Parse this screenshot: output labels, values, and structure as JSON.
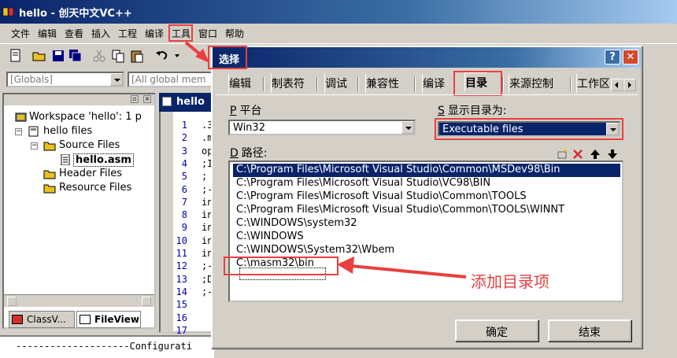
{
  "window": {
    "title": "hello - 创天中文VC++"
  },
  "menu": [
    "文件",
    "编辑",
    "查看",
    "插入",
    "工程",
    "编译",
    "工具",
    "窗口",
    "帮助"
  ],
  "toolbar": {
    "globals_combo": "[Globals]",
    "members_combo": "[All global mem"
  },
  "workspace": {
    "root": "Workspace 'hello': 1 p",
    "project": "hello files",
    "source_folder": "Source Files",
    "source_file": "hello.asm",
    "header_folder": "Header Files",
    "resource_folder": "Resource Files",
    "tabs": [
      "ClassV...",
      "FileView"
    ]
  },
  "editor": {
    "tab": "hello",
    "line_numbers": [
      "1",
      "2",
      "3",
      "4",
      "5",
      "6",
      "7",
      "8",
      "9",
      "10",
      "11",
      "12",
      "13",
      "14",
      "15",
      "16",
      "17"
    ],
    "lines": [
      ".3",
      ".m",
      "op",
      ";I",
      ";",
      ";-",
      "in",
      "in",
      "in",
      "in",
      "in",
      ";-",
      ";D",
      ";-",
      "",
      "",
      ""
    ]
  },
  "output": {
    "text": "--------------------Configurati"
  },
  "dialog": {
    "title": "选择",
    "help_label": "?",
    "close_label": "✕",
    "tabs": [
      "编辑",
      "制表符",
      "调试",
      "兼容性",
      "编译",
      "目录",
      "来源控制",
      "工作区"
    ],
    "active_tab": "目录",
    "platform_label_key": "P",
    "platform_label": "平台",
    "platform_value": "Win32",
    "show_dirs_key": "S",
    "show_dirs_label": "显示目录为:",
    "show_dirs_value": "Executable files",
    "dirs_key": "D",
    "dirs_label": "路径:",
    "directories": [
      "C:\\Program Files\\Microsoft Visual Studio\\Common\\MSDev98\\Bin",
      "C:\\Program Files\\Microsoft Visual Studio\\VC98\\BIN",
      "C:\\Program Files\\Microsoft Visual Studio\\Common\\TOOLS",
      "C:\\Program Files\\Microsoft Visual Studio\\Common\\TOOLS\\WINNT",
      "C:\\WINDOWS\\system32",
      "C:\\WINDOWS",
      "C:\\WINDOWS\\System32\\Wbem",
      "C:\\masm32\\bin"
    ],
    "ok_button": "确定",
    "cancel_button": "结束"
  },
  "annotation": {
    "text": "添加目录项"
  },
  "colors": {
    "highlight": "#e84040",
    "selection": "#0a246a",
    "face": "#d4d0c8"
  }
}
